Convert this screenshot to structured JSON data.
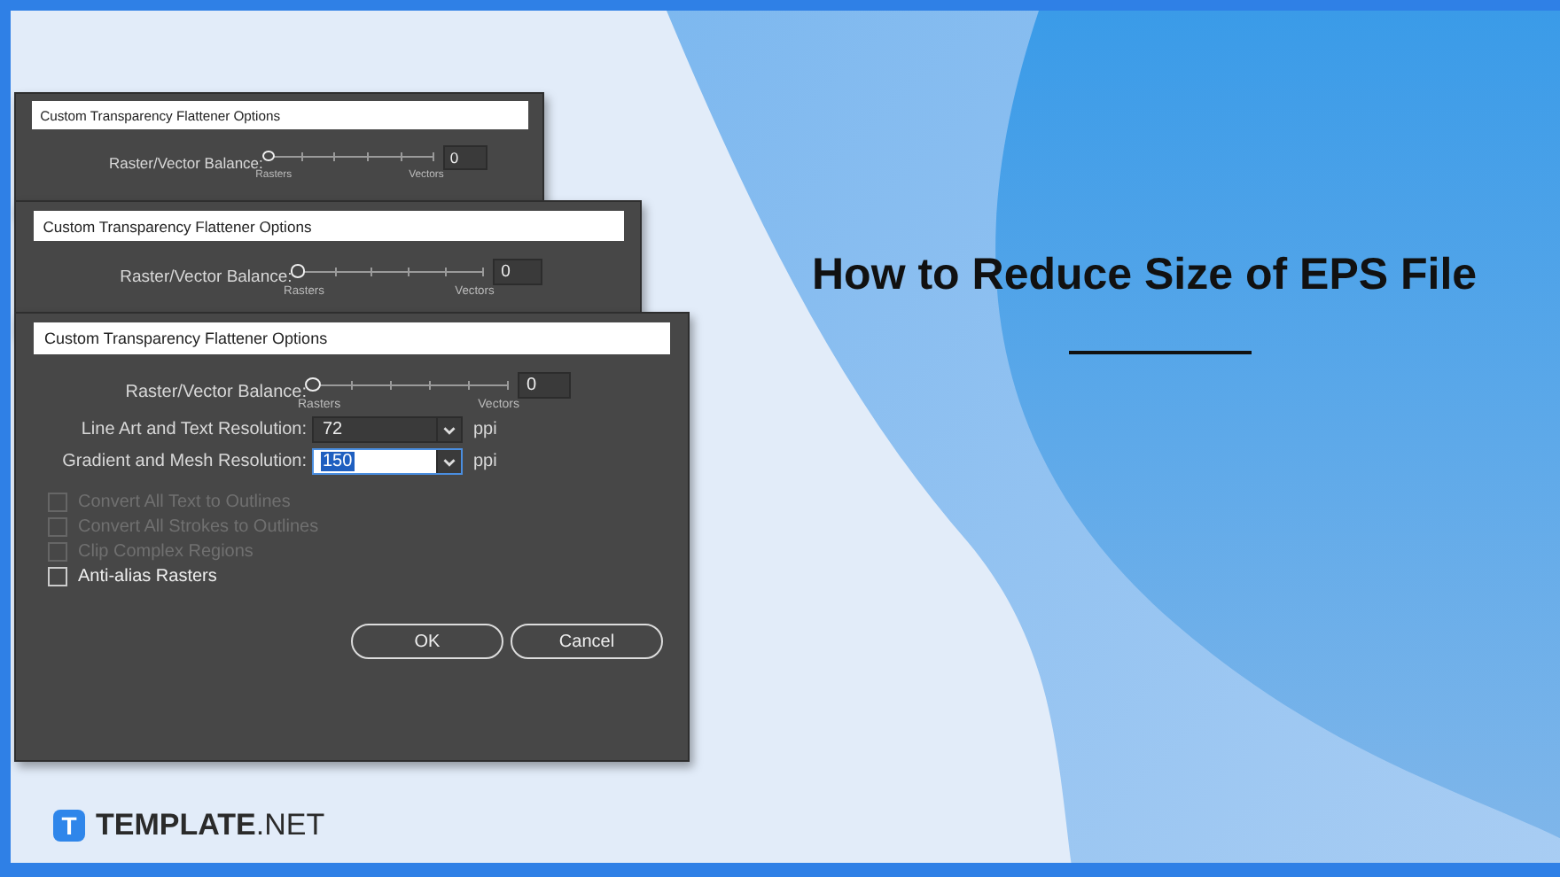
{
  "dialogs": [
    {
      "title": "Custom Transparency Flattener Options",
      "balance": {
        "label": "Raster/Vector Balance:",
        "level": 0,
        "value": "0",
        "left_label": "Rasters",
        "right_label": "Vectors"
      }
    },
    {
      "title": "Custom Transparency Flattener Options",
      "balance": {
        "label": "Raster/Vector Balance:",
        "level": 0,
        "value": "0",
        "left_label": "Rasters",
        "right_label": "Vectors"
      }
    },
    {
      "title": "Custom Transparency Flattener Options",
      "balance": {
        "label": "Raster/Vector Balance:",
        "level": 0,
        "value": "0",
        "left_label": "Rasters",
        "right_label": "Vectors"
      },
      "resolutions": [
        {
          "label": "Line Art and Text Resolution:",
          "value": "72",
          "unit": "ppi",
          "selected": false
        },
        {
          "label": "Gradient and Mesh Resolution:",
          "value": "150",
          "unit": "ppi",
          "selected": true
        }
      ],
      "options": [
        {
          "label": "Convert All Text to Outlines",
          "checked": false,
          "disabled": true
        },
        {
          "label": "Convert All Strokes to Outlines",
          "checked": false,
          "disabled": true
        },
        {
          "label": "Clip Complex Regions",
          "checked": false,
          "disabled": true
        },
        {
          "label": "Anti-alias Rasters",
          "checked": false,
          "disabled": false
        }
      ],
      "buttons": [
        "OK",
        "Cancel"
      ]
    }
  ],
  "heading": "How to Reduce Size of EPS File",
  "logo": {
    "mark": "T",
    "name": "TEMPLATE",
    "suffix": ".NET"
  }
}
